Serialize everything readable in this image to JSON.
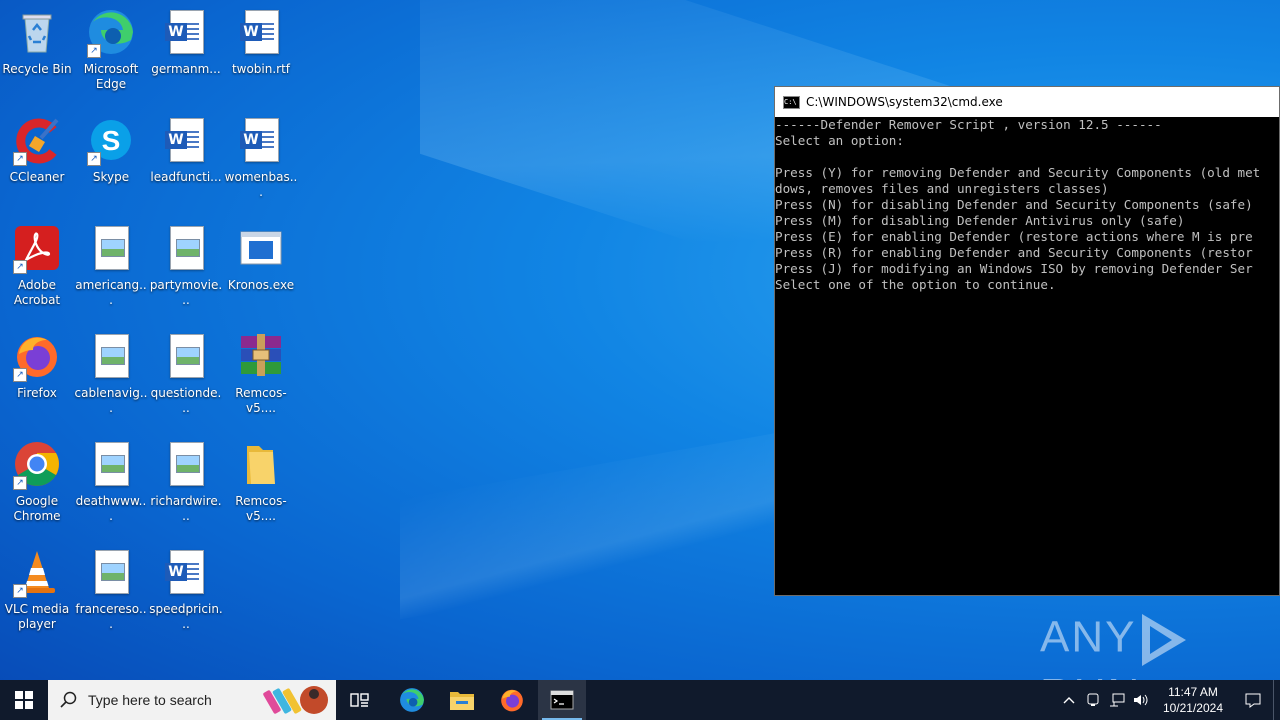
{
  "desktop": {
    "icons": [
      {
        "label": "Recycle Bin"
      },
      {
        "label": "Microsoft Edge"
      },
      {
        "label": "germanm..."
      },
      {
        "label": "twobin.rtf"
      },
      {
        "label": "CCleaner"
      },
      {
        "label": "Skype"
      },
      {
        "label": "leadfuncti..."
      },
      {
        "label": "womenbas..."
      },
      {
        "label": "Adobe Acrobat"
      },
      {
        "label": "americang..."
      },
      {
        "label": "partymovie..."
      },
      {
        "label": "Kronos.exe"
      },
      {
        "label": "Firefox"
      },
      {
        "label": "cablenavig..."
      },
      {
        "label": "questionde..."
      },
      {
        "label": "Remcos-v5...."
      },
      {
        "label": "Google Chrome"
      },
      {
        "label": "deathwww..."
      },
      {
        "label": "richardwire..."
      },
      {
        "label": "Remcos-v5...."
      },
      {
        "label": "VLC media player"
      },
      {
        "label": "francereso..."
      },
      {
        "label": "speedpricin..."
      }
    ]
  },
  "cmd": {
    "title": "C:\\WINDOWS\\system32\\cmd.exe",
    "output": "------Defender Remover Script , version 12.5 ------\nSelect an option:\n\nPress (Y) for removing Defender and Security Components (old met\ndows, removes files and unregisters classes)\nPress (N) for disabling Defender and Security Components (safe)\nPress (M) for disabling Defender Antivirus only (safe)\nPress (E) for enabling Defender (restore actions where M is pre\nPress (R) for enabling Defender and Security Components (restor\nPress (J) for modifying an Windows ISO by removing Defender Ser\nSelect one of the option to continue."
  },
  "watermark": {
    "left": "ANY",
    "right": "RUN"
  },
  "taskbar": {
    "search_placeholder": "Type here to search",
    "time": "11:47 AM",
    "date": "10/21/2024"
  },
  "colors": {
    "accent": "#76b9ed",
    "taskbar": "#101a2c",
    "console_text": "#c0c0c0"
  }
}
